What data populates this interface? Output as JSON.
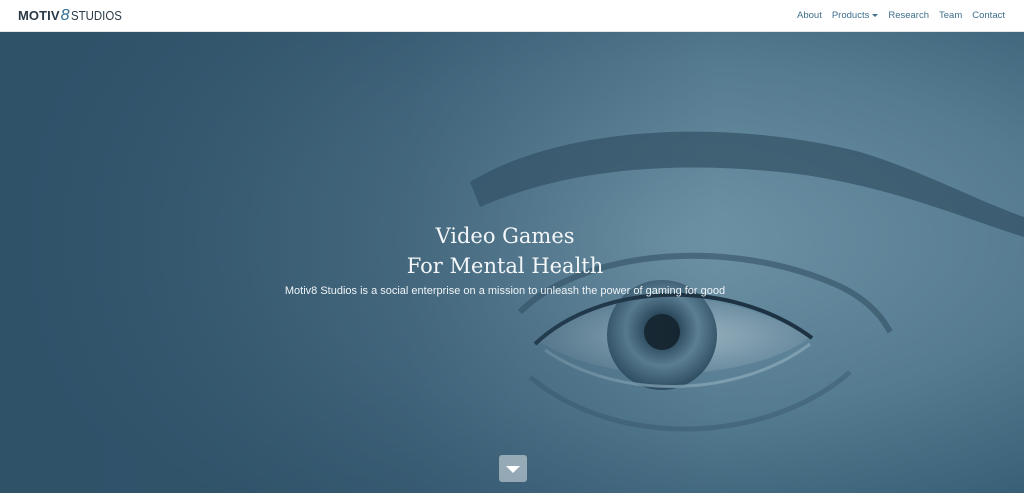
{
  "brand": {
    "part1": "MOTIV",
    "part2": "8",
    "part3": "STUDIOS"
  },
  "nav": {
    "about": "About",
    "products": "Products",
    "research": "Research",
    "team": "Team",
    "contact": "Contact"
  },
  "hero": {
    "title_line1": "Video Games",
    "title_line2": "For Mental Health",
    "subtitle": "Motiv8 Studios is a social enterprise on a mission to unleash the power of gaming for good",
    "background_image": "close-up eye with blue tint",
    "scroll_icon": "chevron-down-icon"
  },
  "colors": {
    "nav_link": "#3f6f8c",
    "hero_tint": "#3f6a84",
    "hero_text": "#f4f7f9"
  }
}
